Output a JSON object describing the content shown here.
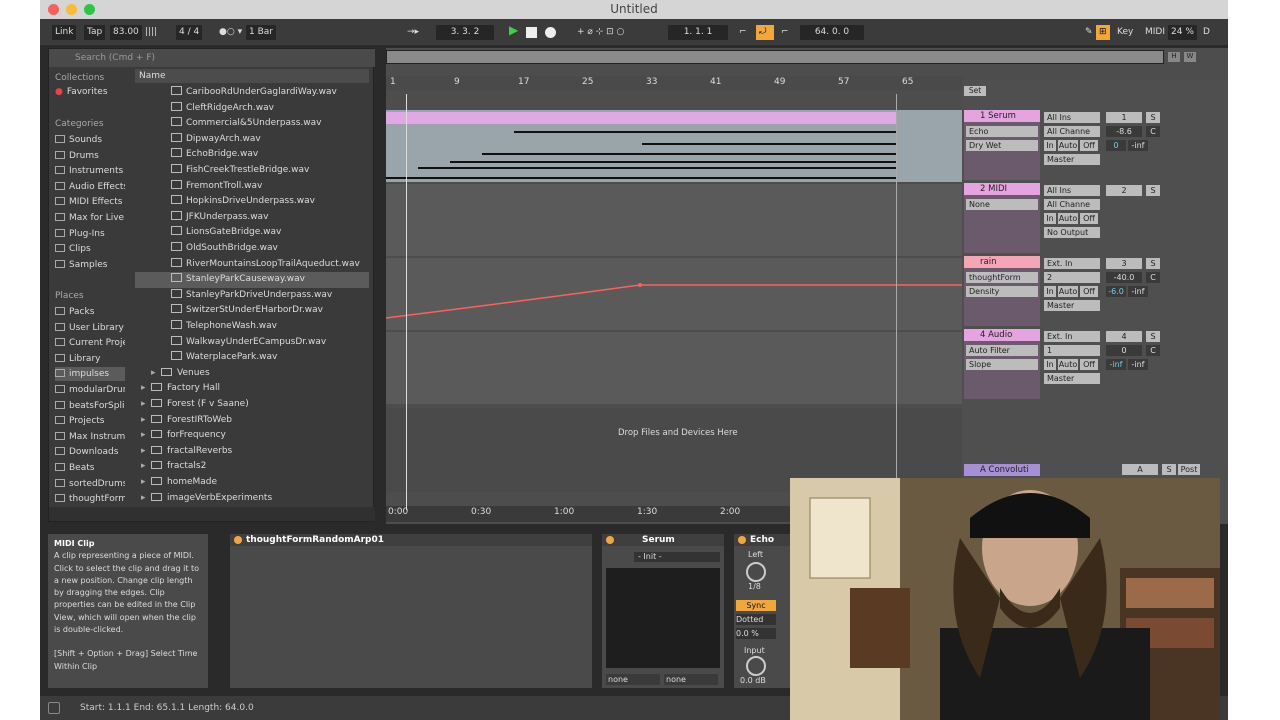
{
  "title": "Untitled",
  "control_bar": {
    "link": "Link",
    "tap": "Tap",
    "tempo": "83.00",
    "time_sig": "4 / 4",
    "quantize": "1 Bar",
    "arrangement_pos": "3.  3.  2",
    "loop_start": "1.  1.  1",
    "loop_length": "64.  0.  0",
    "key": "Key",
    "midi": "MIDI",
    "cpu": "24 %",
    "d": "D"
  },
  "browser": {
    "search_placeholder": "Search (Cmd + F)",
    "collections_header": "Collections",
    "favorites": "Favorites",
    "categories_header": "Categories",
    "categories": [
      "Sounds",
      "Drums",
      "Instruments",
      "Audio Effects",
      "MIDI Effects",
      "Max for Live",
      "Plug-Ins",
      "Clips",
      "Samples"
    ],
    "places_header": "Places",
    "places": [
      "Packs",
      "User Library",
      "Current Project",
      "Library",
      "impulses",
      "modularDrums",
      "beatsForSplice",
      "Projects",
      "Max Instruments",
      "Downloads",
      "Beats",
      "sortedDrums",
      "thoughtForm"
    ],
    "name_header": "Name",
    "files": [
      "CaribooRdUnderGaglardiWay.wav",
      "CleftRidgeArch.wav",
      "Commercial&5Underpass.wav",
      "DipwayArch.wav",
      "EchoBridge.wav",
      "FishCreekTrestleBridge.wav",
      "FremontTroll.wav",
      "HopkinsDriveUnderpass.wav",
      "JFKUnderpass.wav",
      "LionsGateBridge.wav",
      "OldSouthBridge.wav",
      "RiverMountainsLoopTrailAqueduct.wav",
      "StanleyParkCauseway.wav",
      "StanleyParkDriveUnderpass.wav",
      "SwitzerStUnderEHarborDr.wav",
      "TelephoneWash.wav",
      "WalkwayUnderECampusDr.wav",
      "WaterplacePark.wav"
    ],
    "folders": [
      "Venues",
      "Factory Hall",
      "Forest (F v Saane)",
      "ForestIRToWeb",
      "forFrequency",
      "fractalReverbs",
      "fractals2",
      "homeMade",
      "imageVerbExperiments"
    ]
  },
  "ruler": {
    "bars": [
      "1",
      "9",
      "17",
      "25",
      "33",
      "41",
      "49",
      "57",
      "65"
    ],
    "times": [
      "0:00",
      "0:30",
      "1:00",
      "1:30",
      "2:00"
    ]
  },
  "drop_hint": "Drop Files and Devices Here",
  "mixer": {
    "set": "Set",
    "tracks": [
      {
        "name": "1 Serum",
        "color": "#e5a3e0",
        "dev1": "Echo",
        "dev2": "Dry Wet",
        "in": "All Ins",
        "ch": "All Channe",
        "num": "1",
        "vol": "-8.6",
        "pan": "C",
        "send": "0",
        "send2": "-inf",
        "out": "Master"
      },
      {
        "name": "2 MIDI",
        "color": "#e5a3e0",
        "dev1": "None",
        "dev2": "",
        "in": "All Ins",
        "ch": "All Channe",
        "num": "2",
        "vol": "",
        "pan": "",
        "send": "",
        "send2": "",
        "out": "No Output"
      },
      {
        "name": "rain",
        "color": "#f5a6b4",
        "dev1": "thoughtForm",
        "dev2": "Density",
        "in": "Ext. In",
        "ch": "2",
        "num": "3",
        "vol": "-40.0",
        "pan": "C",
        "send": "-6.0",
        "send2": "-inf",
        "out": "Master"
      },
      {
        "name": "4 Audio",
        "color": "#e5a3e0",
        "dev1": "Auto Filter",
        "dev2": "Slope",
        "in": "Ext. In",
        "ch": "1",
        "num": "4",
        "vol": "0",
        "pan": "C",
        "send": "-inf",
        "send2": "-inf",
        "out": "Master"
      }
    ],
    "return_name": "A Convoluti",
    "return_num": "A",
    "return_post": "Post",
    "in_label": "In",
    "auto_label": "Auto",
    "off_label": "Off",
    "s_label": "S"
  },
  "detail": {
    "info_title": "MIDI Clip",
    "info_text": "A clip representing a piece of MIDI. Click to select the clip and drag it to a new position. Change clip length by dragging the edges. Clip properties can be edited in the Clip View, which will open when the clip is double-clicked.",
    "info_shortcut": "[Shift + Option + Drag] Select Time Within Clip",
    "clip_name": "thoughtFormRandomArp01",
    "serum_name": "Serum",
    "serum_preset": "- Init -",
    "none1": "none",
    "none2": "none",
    "echo_name": "Echo",
    "echo_left": "Left",
    "echo_rate": "1/8",
    "echo_sync": "Sync",
    "echo_mode": "Dotted",
    "echo_pct": "0.0 %",
    "echo_input": "Input",
    "echo_db": "0.0 dB"
  },
  "status": "Start: 1.1.1  End: 65.1.1  Length: 64.0.0"
}
